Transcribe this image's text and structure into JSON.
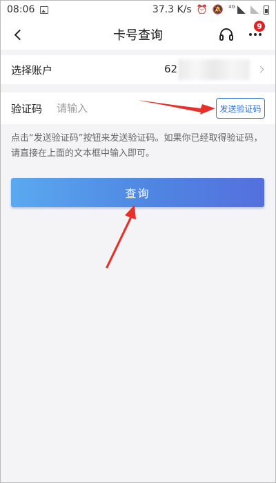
{
  "status_bar": {
    "time": "08:06",
    "network_speed": "37.3 K/s",
    "network_type": "4G",
    "icons": [
      "image-icon",
      "alarm-icon",
      "mute-icon",
      "signal-icon",
      "signal-icon",
      "battery-icon"
    ]
  },
  "header": {
    "title": "卡号查询",
    "back_icon": "chevron-left-icon",
    "support_icon": "headset-icon",
    "more_icon": "more-dots-icon",
    "notification_count": "9"
  },
  "account_row": {
    "label": "选择账户",
    "value_visible": "62"
  },
  "code_row": {
    "label": "验证码",
    "placeholder": "请输入",
    "value": "",
    "send_button_label": "发送验证码"
  },
  "hint": {
    "text": "点击“发送验证码”按钮来发送验证码。如果你已经取得验证码，请直接在上面的文本框中输入即可。"
  },
  "query_button": {
    "label": "查询"
  },
  "colors": {
    "accent": "#3a78e0",
    "button_gradient_start": "#5aa9f0",
    "button_gradient_end": "#5470dd",
    "badge": "#e02020",
    "annotation_arrow": "#e8302a",
    "background": "#f4f4f6"
  }
}
